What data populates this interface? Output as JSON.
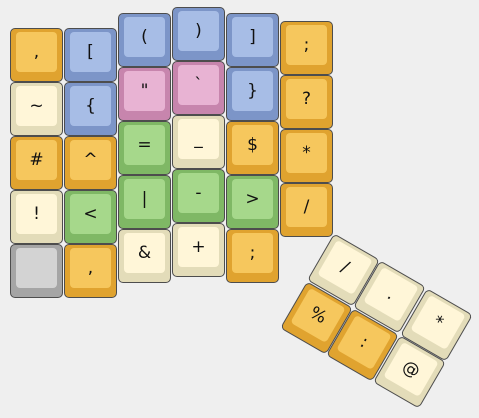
{
  "keys": [
    {
      "label": ",",
      "color": "orange"
    },
    {
      "label": "[",
      "color": "blue"
    },
    {
      "label": "(",
      "color": "blue"
    },
    {
      "label": ")",
      "color": "blue"
    },
    {
      "label": "]",
      "color": "blue"
    },
    {
      "label": ";",
      "color": "orange"
    },
    {
      "label": "~",
      "color": "cream"
    },
    {
      "label": "{",
      "color": "blue"
    },
    {
      "label": "\"",
      "color": "pink"
    },
    {
      "label": "`",
      "color": "pink"
    },
    {
      "label": "}",
      "color": "blue"
    },
    {
      "label": "?",
      "color": "orange"
    },
    {
      "label": "#",
      "color": "orange"
    },
    {
      "label": "^",
      "color": "orange"
    },
    {
      "label": "=",
      "color": "green"
    },
    {
      "label": "_",
      "color": "cream"
    },
    {
      "label": "$",
      "color": "orange"
    },
    {
      "label": "*",
      "color": "orange"
    },
    {
      "label": "!",
      "color": "cream"
    },
    {
      "label": "<",
      "color": "green"
    },
    {
      "label": "|",
      "color": "green"
    },
    {
      "label": "-",
      "color": "green"
    },
    {
      "label": ">",
      "color": "green"
    },
    {
      "label": "/",
      "color": "orange"
    },
    {
      "label": "",
      "color": "gray"
    },
    {
      "label": ",",
      "color": "orange"
    },
    {
      "label": "&",
      "color": "cream"
    },
    {
      "label": "+",
      "color": "cream"
    },
    {
      "label": ";",
      "color": "orange"
    },
    {
      "label": "/",
      "color": "cream"
    },
    {
      "label": ".",
      "color": "cream"
    },
    {
      "label": "*",
      "color": "cream"
    },
    {
      "label": "%",
      "color": "orange"
    },
    {
      "label": ":",
      "color": "orange"
    },
    {
      "label": "@",
      "color": "cream"
    }
  ]
}
